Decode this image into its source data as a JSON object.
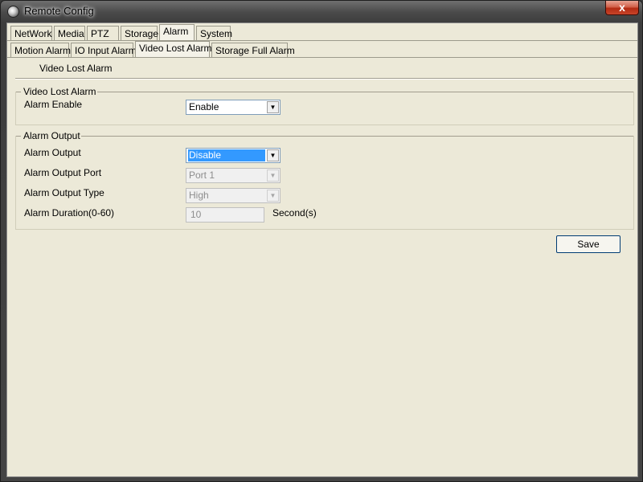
{
  "window": {
    "title": "Remote Config",
    "close_glyph": "x"
  },
  "main_tabs": [
    "NetWork",
    "Media",
    "PTZ",
    "Storage",
    "Alarm",
    "System"
  ],
  "main_active_tab": "Alarm",
  "sub_tabs": [
    "Motion Alarm",
    "IO Input Alarm",
    "Video Lost Alarm",
    "Storage Full Alarm"
  ],
  "sub_active_tab": "Video Lost Alarm",
  "page_subtitle": "Video Lost Alarm",
  "video_lost_group": {
    "legend": "Video Lost Alarm",
    "alarm_enable_label": "Alarm Enable",
    "alarm_enable_value": "Enable"
  },
  "alarm_output_group": {
    "legend": "Alarm Output",
    "output_label": "Alarm Output",
    "output_value": "Disable",
    "port_label": "Alarm Output Port",
    "port_value": "Port 1",
    "type_label": "Alarm Output Type",
    "type_value": "High",
    "duration_label": "Alarm Duration(0-60)",
    "duration_value": "10",
    "duration_unit": "Second(s)"
  },
  "save_label": "Save",
  "icons": {
    "app": "camera-app-icon",
    "close": "close-icon",
    "dropdown": "chevron-down-icon"
  }
}
